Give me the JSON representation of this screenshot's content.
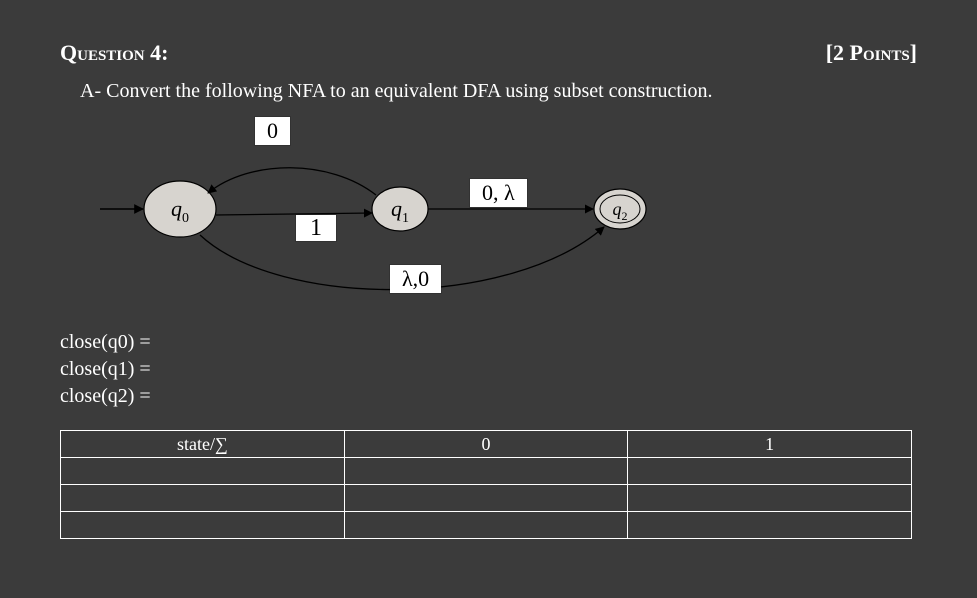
{
  "header": {
    "title": "Question 4:",
    "points": "[2 Points]"
  },
  "prompt": "A- Convert the following NFA to an equivalent DFA using subset construction.",
  "nfa": {
    "states": {
      "q0": {
        "name": "q",
        "sub": "0"
      },
      "q1": {
        "name": "q",
        "sub": "1"
      },
      "q2": {
        "name": "q",
        "sub": "2"
      }
    },
    "labels": {
      "top": "0",
      "mid": "1",
      "upper_right": "0, λ",
      "lower_mid": "λ,0"
    }
  },
  "closures": [
    "close(q0) =",
    "close(q1) =",
    "close(q2) ="
  ],
  "table": {
    "headers": [
      "state/∑",
      "0",
      "1"
    ],
    "rows": [
      [
        "",
        "",
        ""
      ],
      [
        "",
        "",
        ""
      ],
      [
        "",
        "",
        ""
      ]
    ]
  }
}
